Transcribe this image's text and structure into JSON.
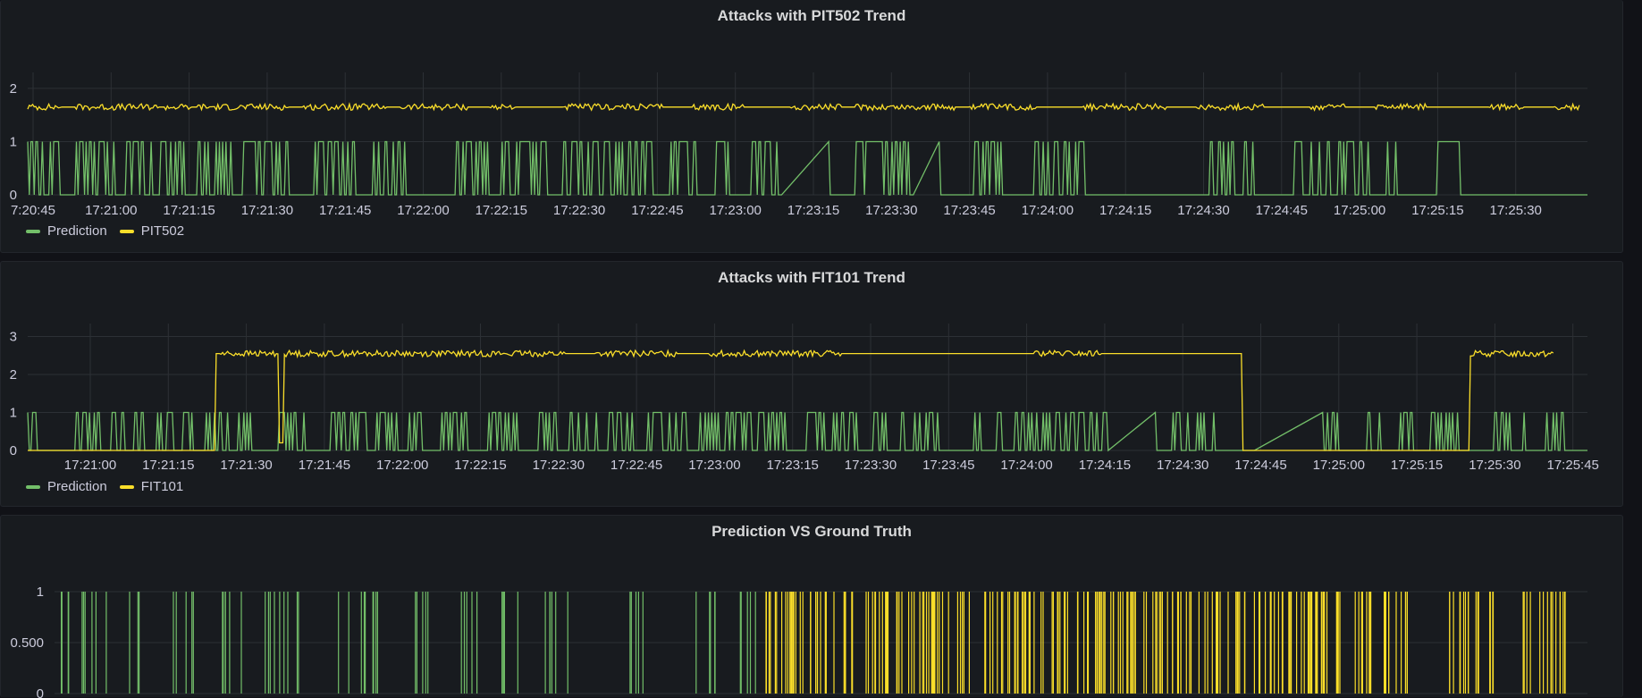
{
  "colors": {
    "prediction": "#73bf69",
    "sensor": "#fade2a",
    "grid": "#2c3035"
  },
  "panels": [
    {
      "title": "Attacks with PIT502 Trend",
      "legend": [
        "Prediction",
        "PIT502"
      ]
    },
    {
      "title": "Attacks with FIT101 Trend",
      "legend": [
        "Prediction",
        "FIT101"
      ]
    },
    {
      "title": "Prediction VS Ground Truth",
      "legend": []
    }
  ],
  "chart_data": [
    {
      "type": "line",
      "title": "Attacks with PIT502 Trend",
      "x_ticks": [
        "7:20:45",
        "17:21:00",
        "17:21:15",
        "17:21:30",
        "17:21:45",
        "17:22:00",
        "17:22:15",
        "17:22:30",
        "17:22:45",
        "17:23:00",
        "17:23:15",
        "17:23:30",
        "17:23:45",
        "17:24:00",
        "17:24:15",
        "17:24:30",
        "17:24:45",
        "17:25:00",
        "17:25:15",
        "17:25:30"
      ],
      "y_ticks": [
        "0",
        "1",
        "2"
      ],
      "ylim": [
        0,
        2.2
      ],
      "series": [
        {
          "name": "Prediction",
          "color": "#73bf69",
          "kind": "binary",
          "active_ranges": [
            [
              0,
              9
            ],
            [
              14,
              19
            ],
            [
              30,
              53
            ],
            [
              61,
              74
            ],
            [
              76,
              98
            ],
            [
              105,
              125
            ],
            [
              133,
              160
            ],
            [
              177,
              201
            ],
            [
              213,
              232
            ],
            [
              264,
              285
            ],
            [
              292,
              296
            ],
            [
              301,
              319
            ],
            [
              330,
              360
            ],
            [
              362,
              387
            ],
            [
              396,
              411
            ],
            [
              424,
              432
            ],
            [
              446,
              484
            ],
            [
              510,
              542
            ],
            [
              583,
              600
            ],
            [
              620,
              650
            ],
            [
              728,
              756
            ],
            [
              780,
              795
            ],
            [
              800,
              810
            ],
            [
              812,
              825
            ],
            [
              837,
              850
            ],
            [
              868,
              881
            ]
          ],
          "ramps": [
            [
              464,
              493
            ],
            [
              545,
              561
            ]
          ]
        },
        {
          "name": "PIT502",
          "color": "#fade2a",
          "kind": "level",
          "baseline": 1.65,
          "noise": 0.06,
          "noisy_ranges": [
            [
              0,
              20
            ],
            [
              30,
              80
            ],
            [
              85,
              100
            ],
            [
              105,
              160
            ],
            [
              170,
              220
            ],
            [
              230,
              270
            ],
            [
              285,
              300
            ],
            [
              330,
              390
            ],
            [
              410,
              440
            ],
            [
              470,
              500
            ],
            [
              510,
              570
            ],
            [
              580,
              620
            ],
            [
              650,
              700
            ],
            [
              720,
              760
            ],
            [
              790,
              810
            ],
            [
              830,
              860
            ],
            [
              900,
              920
            ],
            [
              940,
              955
            ]
          ]
        }
      ]
    },
    {
      "type": "line",
      "title": "Attacks with FIT101 Trend",
      "x_ticks": [
        "17:21:00",
        "17:21:15",
        "17:21:30",
        "17:21:45",
        "17:22:00",
        "17:22:15",
        "17:22:30",
        "17:22:45",
        "17:23:00",
        "17:23:15",
        "17:23:30",
        "17:23:45",
        "17:24:00",
        "17:24:15",
        "17:24:30",
        "17:24:45",
        "17:25:00",
        "17:25:15",
        "17:25:30",
        "17:25:45"
      ],
      "y_ticks": [
        "0",
        "1",
        "2",
        "3"
      ],
      "ylim": [
        0,
        3.2
      ],
      "series": [
        {
          "name": "Prediction",
          "color": "#73bf69",
          "kind": "binary",
          "active_ranges": [
            [
              0,
              5
            ],
            [
              30,
              44
            ],
            [
              52,
              60
            ],
            [
              66,
              71
            ],
            [
              80,
              90
            ],
            [
              96,
              103
            ],
            [
              110,
              115
            ],
            [
              118,
              126
            ],
            [
              130,
              140
            ],
            [
              155,
              173
            ],
            [
              187,
              200
            ],
            [
              202,
              210
            ],
            [
              215,
              230
            ],
            [
              235,
              242
            ],
            [
              255,
              270
            ],
            [
              284,
              301
            ],
            [
              315,
              325
            ],
            [
              334,
              345
            ],
            [
              350,
              365
            ],
            [
              369,
              374
            ],
            [
              382,
              390
            ],
            [
              395,
              405
            ],
            [
              414,
              425
            ],
            [
              430,
              445
            ],
            [
              450,
              470
            ],
            [
              480,
              490
            ],
            [
              496,
              510
            ],
            [
              521,
              531
            ],
            [
              538,
              542
            ],
            [
              546,
              562
            ],
            [
              583,
              600
            ],
            [
              608,
              660
            ],
            [
              662,
              665
            ],
            [
              690,
              697
            ],
            [
              705,
              715
            ],
            [
              720,
              730
            ],
            [
              760,
              793
            ],
            [
              800,
              808
            ],
            [
              825,
              833
            ],
            [
              845,
              852
            ],
            [
              864,
              880
            ],
            [
              903,
              912
            ],
            [
              921,
              923
            ],
            [
              935,
              946
            ]
          ],
          "ramps": [
            [
              665,
              694
            ],
            [
              755,
              797
            ]
          ]
        },
        {
          "name": "FIT101",
          "color": "#fade2a",
          "kind": "level",
          "baseline": 2.55,
          "noise": 0.08,
          "segments": [
            [
              0,
              116,
              0
            ],
            [
              116,
              119,
              2.55
            ],
            [
              119,
              155,
              2.55
            ],
            [
              155,
              158,
              0.2
            ],
            [
              158,
              748,
              2.55
            ],
            [
              748,
              752,
              0
            ],
            [
              752,
              888,
              0
            ],
            [
              888,
              893,
              2.55
            ],
            [
              893,
              940,
              2.55
            ]
          ],
          "noisy_ranges": [
            [
              119,
              330
            ],
            [
              350,
              400
            ],
            [
              420,
              500
            ],
            [
              620,
              660
            ],
            [
              888,
              940
            ]
          ]
        }
      ]
    },
    {
      "type": "bar",
      "title": "Prediction VS Ground Truth",
      "y_ticks": [
        "0",
        "0.500",
        "1"
      ],
      "ylim": [
        0,
        1
      ],
      "series": [
        {
          "name": "Prediction",
          "color": "#73bf69",
          "kind": "spikes",
          "spans": [
            [
              0,
              16
            ],
            [
              22,
              45
            ],
            [
              60,
              72
            ],
            [
              100,
              120
            ],
            [
              140,
              165
            ],
            [
              175,
              210
            ],
            [
              240,
              280
            ],
            [
              300,
              318
            ],
            [
              340,
              360
            ],
            [
              375,
              395
            ],
            [
              415,
              440
            ],
            [
              480,
              500
            ],
            [
              540,
              565
            ],
            [
              580,
              600
            ]
          ],
          "count": 80
        },
        {
          "name": "Ground Truth",
          "color": "#fade2a",
          "kind": "spikes",
          "spans": [
            [
              603,
              1093
            ],
            [
              1100,
              1118
            ],
            [
              1125,
              1150
            ],
            [
              1180,
              1220
            ],
            [
              1245,
              1285
            ]
          ],
          "count": 260
        }
      ]
    }
  ]
}
